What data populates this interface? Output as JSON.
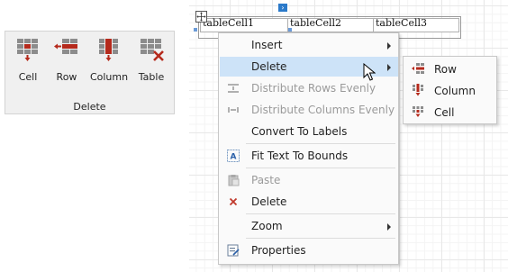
{
  "ribbon": {
    "group_caption": "Delete",
    "buttons": [
      {
        "label": "Cell",
        "icon": "delete-cell-icon"
      },
      {
        "label": "Row",
        "icon": "delete-row-icon"
      },
      {
        "label": "Column",
        "icon": "delete-column-icon"
      },
      {
        "label": "Table",
        "icon": "delete-table-icon"
      }
    ]
  },
  "table": {
    "cells": [
      "tableCell1",
      "tableCell2",
      "tableCell3"
    ]
  },
  "context_menu": {
    "items": [
      {
        "label": "Insert",
        "submenu": true,
        "enabled": true
      },
      {
        "label": "Delete",
        "submenu": true,
        "enabled": true,
        "highlighted": true
      },
      {
        "label": "Distribute Rows Evenly",
        "enabled": false,
        "icon": "distribute-rows-icon"
      },
      {
        "label": "Distribute Columns Evenly",
        "enabled": false,
        "icon": "distribute-columns-icon"
      },
      {
        "label": "Convert To Labels",
        "enabled": true
      },
      {
        "label": "Fit Text To Bounds",
        "enabled": true,
        "icon": "fit-text-icon"
      },
      {
        "label": "Paste",
        "enabled": false,
        "icon": "paste-icon"
      },
      {
        "label": "Delete",
        "enabled": true,
        "icon": "delete-x-icon"
      },
      {
        "label": "Zoom",
        "submenu": true,
        "enabled": true
      },
      {
        "label": "Properties",
        "enabled": true,
        "icon": "properties-icon"
      }
    ]
  },
  "delete_submenu": {
    "items": [
      {
        "label": "Row",
        "icon": "delete-row-icon"
      },
      {
        "label": "Column",
        "icon": "delete-column-icon"
      },
      {
        "label": "Cell",
        "icon": "delete-cell-icon"
      }
    ]
  },
  "colors": {
    "accent": "#b52a1c",
    "highlight": "#cde3f8",
    "grid_cell": "#8c8c8c",
    "smart_tag": "#2a79c9"
  }
}
